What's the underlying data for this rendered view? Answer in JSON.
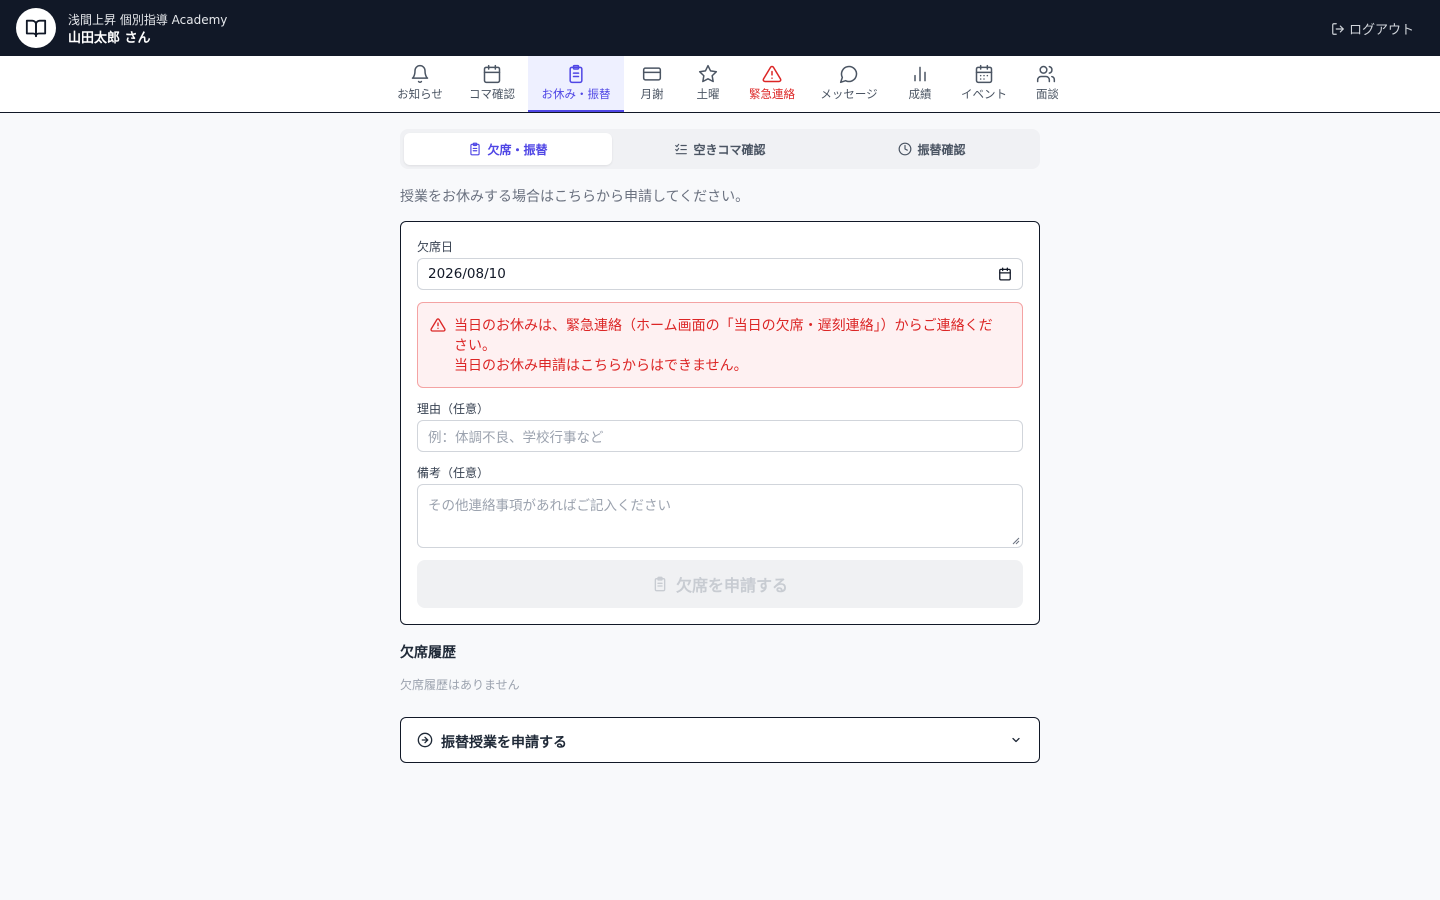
{
  "header": {
    "school_name": "浅間上昇 個別指導 Academy",
    "student_name": "山田太郎 さん",
    "logout_label": "ログアウト"
  },
  "nav": {
    "items": [
      {
        "label": "お知らせ",
        "icon": "bell-icon"
      },
      {
        "label": "コマ確認",
        "icon": "calendar-icon"
      },
      {
        "label": "お休み・振替",
        "icon": "clipboard-icon",
        "active": true
      },
      {
        "label": "月謝",
        "icon": "card-icon"
      },
      {
        "label": "土曜",
        "icon": "star-icon"
      },
      {
        "label": "緊急連絡",
        "icon": "warning-icon",
        "danger": true
      },
      {
        "label": "メッセージ",
        "icon": "chat-icon"
      },
      {
        "label": "成績",
        "icon": "bar-chart-icon"
      },
      {
        "label": "イベント",
        "icon": "calendar-grid-icon"
      },
      {
        "label": "面談",
        "icon": "users-icon"
      }
    ]
  },
  "subtabs": [
    {
      "label": "欠席・振替",
      "active": true
    },
    {
      "label": "空きコマ確認"
    },
    {
      "label": "振替確認"
    }
  ],
  "intro": "授業をお休みする場合はこちらから申請してください。",
  "form": {
    "date_label": "欠席日",
    "date_value": "2026/08/10",
    "alert_line1": "当日のお休みは、緊急連絡（ホーム画面の「当日の欠席・遅刻連絡」）からご連絡ください。",
    "alert_line2": "当日のお休み申請はこちらからはできません。",
    "reason_label": "理由（任意）",
    "reason_placeholder": "例：体調不良、学校行事など",
    "note_label": "備考（任意）",
    "note_placeholder": "その他連絡事項があればご記入ください",
    "submit_label": "欠席を申請する"
  },
  "history": {
    "title": "欠席履歴",
    "empty": "欠席履歴はありません"
  },
  "accordion": {
    "title": "振替授業を申請する"
  },
  "colors": {
    "header_bg": "#111827",
    "accent": "#4f46e5",
    "danger": "#dc2626"
  }
}
